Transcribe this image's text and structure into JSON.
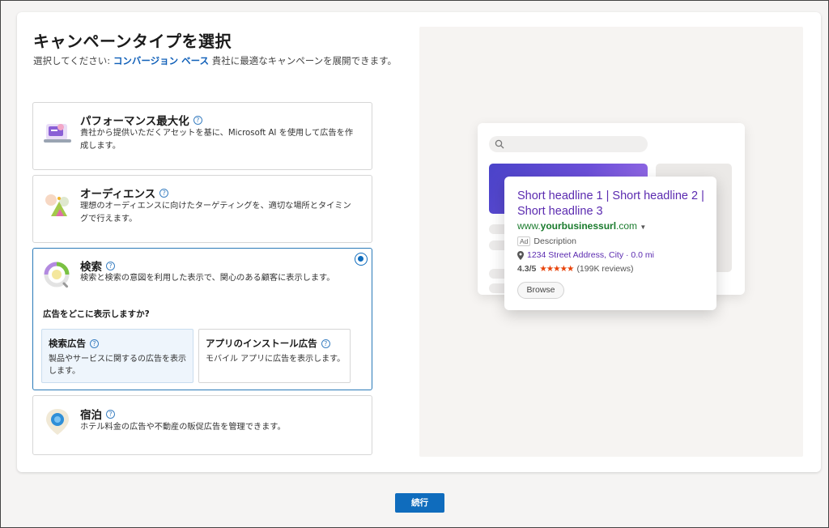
{
  "page": {
    "title": "キャンペーンタイプを選択",
    "subtitle_prefix": "選択してください:",
    "subtitle_goal": "コンバージョン ベース",
    "subtitle_suffix": "貴社に最適なキャンペーンを展開できます。"
  },
  "options": [
    {
      "title": "パフォーマンス最大化",
      "description": "貴社から提供いただくアセットを基に、Microsoft AI を使用して広告を作成します。",
      "icon": "performance-max-icon",
      "selected": false
    },
    {
      "title": "オーディエンス",
      "description": "理想のオーディエンスに向けたターゲティングを、適切な場所とタイミングで行えます。",
      "icon": "audience-icon",
      "selected": false
    },
    {
      "title": "検索",
      "description": "検索と検索の意図を利用した表示で、関心のある顧客に表示します。",
      "icon": "search-campaign-icon",
      "selected": true,
      "question": "広告をどこに表示しますか?",
      "sub_options": [
        {
          "title": "検索広告",
          "description": "製品やサービスに関するの広告を表示します。",
          "selected": true
        },
        {
          "title": "アプリのインストール広告",
          "description": "モバイル アプリに広告を表示します。",
          "selected": false
        }
      ]
    },
    {
      "title": "宿泊",
      "description": "ホテル料金の広告や不動産の販促広告を管理できます。",
      "icon": "hotel-pin-icon",
      "selected": false
    }
  ],
  "preview": {
    "headline": "Short headline 1 | Short headline 2 | Short headline 3",
    "url_prefix": "www.",
    "url_bold": "yourbusinessurl",
    "url_suffix": ".com",
    "ad_label": "Ad",
    "description": "Description",
    "address": "1234 Street Address, City · 0.0 mi",
    "rating": "4.3/5",
    "stars": "★★★★★",
    "reviews": "(199K reviews)",
    "browse_label": "Browse"
  },
  "footer": {
    "continue_label": "続行"
  },
  "colors": {
    "accent": "#0f6cbd",
    "headline": "#5b2bb0",
    "url": "#1a7b2d",
    "stars": "#e8430a"
  }
}
